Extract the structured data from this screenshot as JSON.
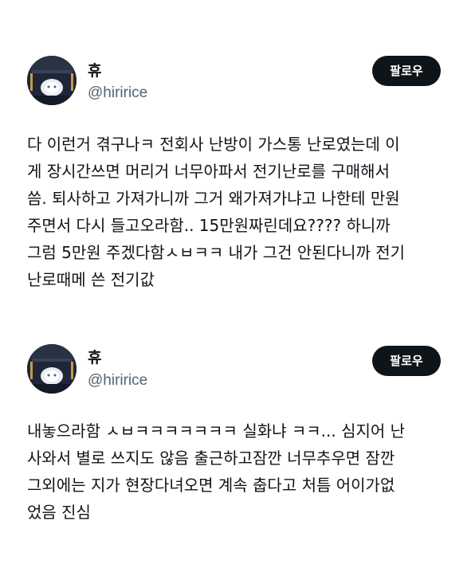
{
  "tweets": [
    {
      "author": {
        "name": "휴",
        "handle": "@hiririce"
      },
      "follow_label": "팔로우",
      "lines": [
        "다 이런거 겪구나ㅋ 전회사 난방이 가스통 난로였는데 이",
        "게 장시간쓰면 머리거 너무아파서 전기난로를 구매해서",
        "씀. 퇴사하고 가져가니까 그거 왜가져가냐고 나한테 만원",
        "주면서 다시 들고오라함.. 15만원짜린데요???? 하니까",
        "그럼 5만원 주겠다함ㅅㅂㅋㅋ 내가 그건 안된다니까 전기",
        "난로때메 쓴 전기값"
      ]
    },
    {
      "author": {
        "name": "휴",
        "handle": "@hiririce"
      },
      "follow_label": "팔로우",
      "lines": [
        "내놓으라함 ㅅㅂㅋㅋㅋㅋㅋㅋㅋ 실화냐 ㅋㅋ... 심지어 난",
        "사와서 별로 쓰지도 않음 출근하고잠깐 너무추우면 잠깐",
        "그외에는 지가 현장다녀오면 계속 춥다고 처틈 어이가없",
        "었음 진심"
      ]
    }
  ],
  "colors": {
    "text": "#0f1419",
    "handle": "#536471",
    "follow_bg": "#0f1419",
    "follow_text": "#ffffff",
    "background": "#ffffff"
  }
}
